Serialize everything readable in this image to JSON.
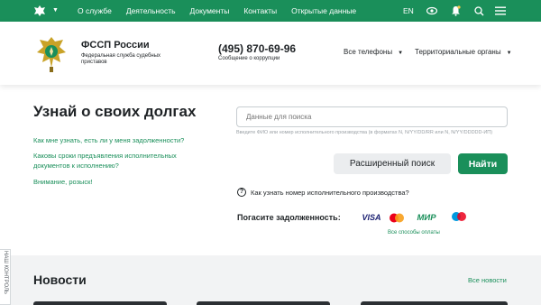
{
  "topbar": {
    "nav": [
      "О службе",
      "Деятельность",
      "Документы",
      "Контакты",
      "Открытые данные"
    ],
    "lang": "EN",
    "icons": [
      "low-vision-icon",
      "bell-icon",
      "search-icon",
      "menu-icon"
    ]
  },
  "header": {
    "brand_title": "ФССП России",
    "brand_sub": "Федеральная служба судебных приставов",
    "phone": "(495) 870-69-96",
    "phone_sub": "Сообщение о коррупции",
    "dropdowns": [
      "Все телефоны",
      "Территориальные органы"
    ]
  },
  "main": {
    "title": "Узнай о своих долгах",
    "links": [
      "Как мне узнать, есть ли у меня задолженности?",
      "Каковы сроки предъявления исполнительных документов к исполнению?",
      "Внимание, розыск!"
    ],
    "search_placeholder": "Данные для поиска",
    "search_hint": "Введите ФИО или номер исполнительного производства (в форматах N, N/YY/DD/RR или N, N/YY/DDDDD-ИП)",
    "advanced_label": "Расширенный поиск",
    "find_label": "Найти",
    "howto_label": "Как узнать номер исполнительного производства?",
    "pay_label": "Погасите задолженность:",
    "visa_label": "VISA",
    "mir_label": "МИР",
    "all_pay_label": "Все способы оплаты"
  },
  "news": {
    "title": "Новости",
    "all_label": "Все новости"
  },
  "side_tab": "НАШ КОНТРОЛЬ",
  "colors": {
    "brand": "#1a8f5a",
    "text": "#1f2326"
  }
}
